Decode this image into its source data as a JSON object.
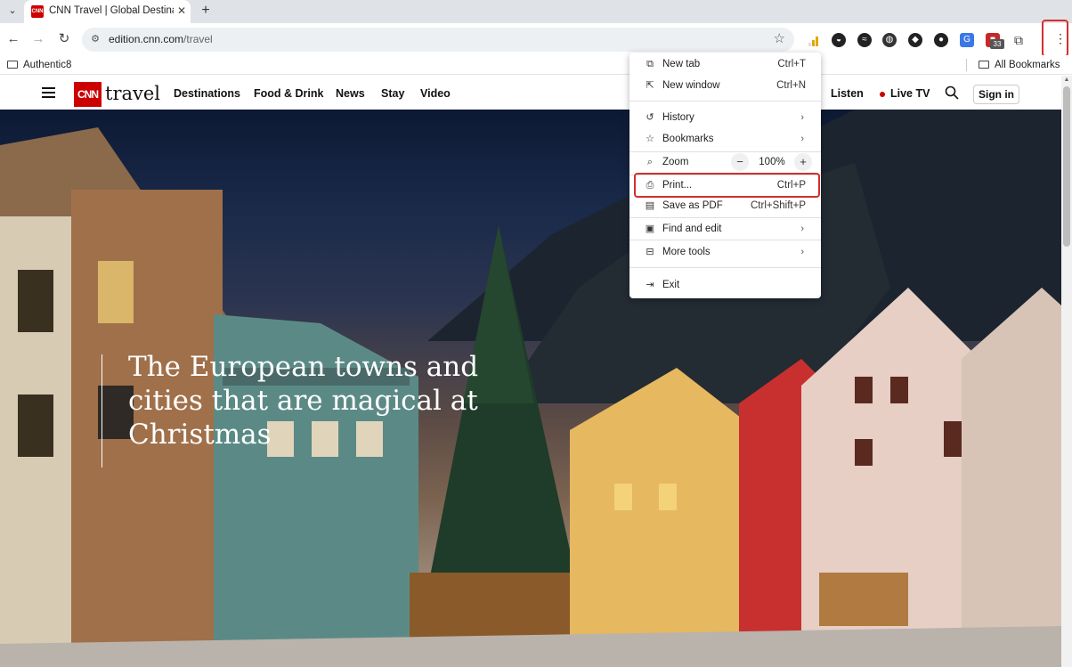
{
  "browser": {
    "tab": {
      "favicon_text": "CNN",
      "title": "CNN Travel | Global Destinations"
    },
    "toolbar": {
      "url_host": "edition.cnn.com",
      "url_path": "/travel",
      "extensions_badge": "33"
    },
    "bookmarks": {
      "left_item": "Authentic8",
      "right_item": "All Bookmarks"
    }
  },
  "page": {
    "logo_mark": "CNN",
    "logo_word": "travel",
    "nav": [
      "Destinations",
      "Food & Drink",
      "News",
      "Stay",
      "Video"
    ],
    "listen": "Listen",
    "live_tv": "Live TV",
    "sign_in": "Sign in",
    "headline": "The European towns and cities that are magical at Christmas"
  },
  "menu": {
    "new_tab": {
      "label": "New tab",
      "shortcut": "Ctrl+T"
    },
    "new_window": {
      "label": "New window",
      "shortcut": "Ctrl+N"
    },
    "history": {
      "label": "History"
    },
    "bookmarks": {
      "label": "Bookmarks"
    },
    "zoom": {
      "label": "Zoom",
      "minus": "−",
      "value": "100%",
      "plus": "+"
    },
    "print": {
      "label": "Print...",
      "shortcut": "Ctrl+P"
    },
    "save_pdf": {
      "label": "Save as PDF",
      "shortcut": "Ctrl+Shift+P"
    },
    "find_edit": {
      "label": "Find and edit"
    },
    "more_tools": {
      "label": "More tools"
    },
    "exit": {
      "label": "Exit"
    }
  },
  "colors": {
    "cnn_red": "#cc0000",
    "highlight_red": "#d32f2f"
  }
}
